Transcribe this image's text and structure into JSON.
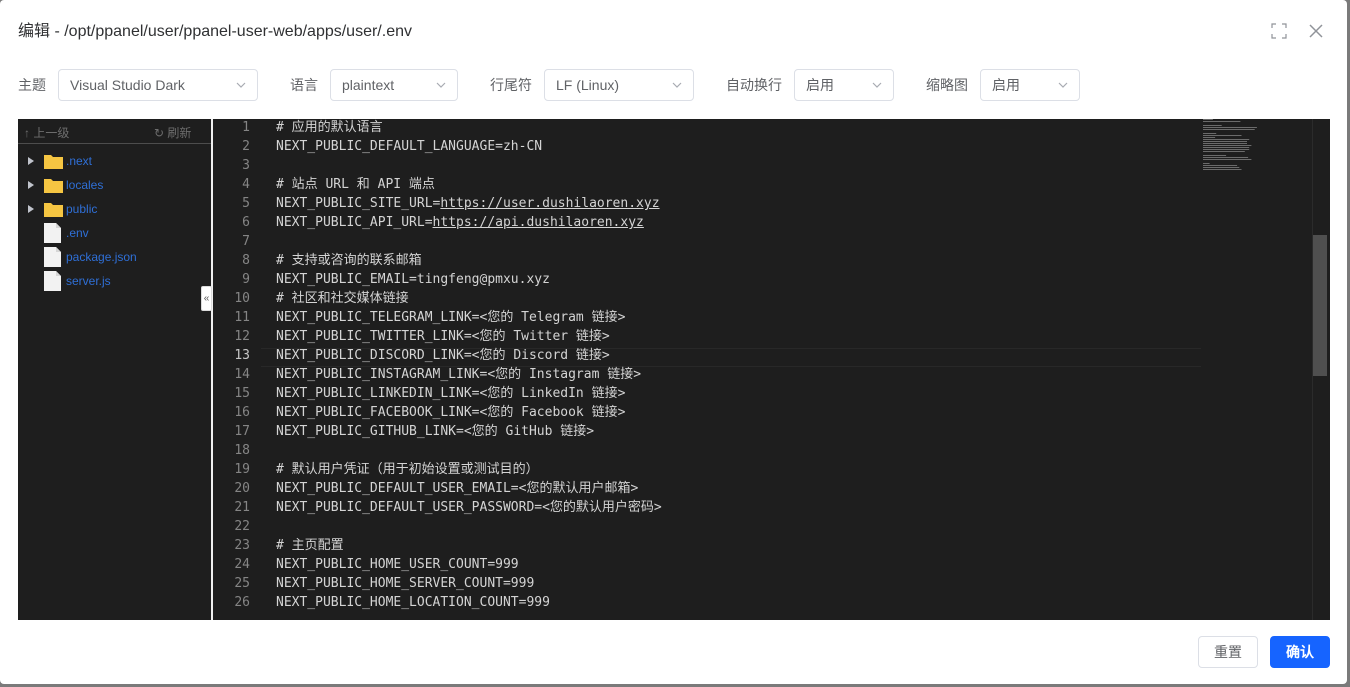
{
  "dialog": {
    "title": "编辑 - /opt/ppanel/user/ppanel-user-web/apps/user/.env",
    "fullscreen_icon": "fullscreen-icon",
    "close_icon": "close-icon"
  },
  "toolbar": {
    "theme_label": "主题",
    "theme_value": "Visual Studio Dark",
    "language_label": "语言",
    "language_value": "plaintext",
    "eol_label": "行尾符",
    "eol_value": "LF (Linux)",
    "wrap_label": "自动换行",
    "wrap_value": "启用",
    "minimap_label": "缩略图",
    "minimap_value": "启用"
  },
  "tree": {
    "up_label": "上一级",
    "refresh_label": "刷新",
    "items": [
      {
        "name": ".next",
        "type": "folder"
      },
      {
        "name": "locales",
        "type": "folder"
      },
      {
        "name": "public",
        "type": "folder"
      },
      {
        "name": ".env",
        "type": "file"
      },
      {
        "name": "package.json",
        "type": "file"
      },
      {
        "name": "server.js",
        "type": "file"
      }
    ]
  },
  "editor": {
    "active_line": 13,
    "lines": [
      "# 应用的默认语言",
      "NEXT_PUBLIC_DEFAULT_LANGUAGE=zh-CN",
      "",
      "# 站点 URL 和 API 端点",
      "NEXT_PUBLIC_SITE_URL=https://user.dushilaoren.xyz",
      "NEXT_PUBLIC_API_URL=https://api.dushilaoren.xyz",
      "",
      "# 支持或咨询的联系邮箱",
      "NEXT_PUBLIC_EMAIL=tingfeng@pmxu.xyz",
      "# 社区和社交媒体链接",
      "NEXT_PUBLIC_TELEGRAM_LINK=<您的 Telegram 链接>",
      "NEXT_PUBLIC_TWITTER_LINK=<您的 Twitter 链接>",
      "NEXT_PUBLIC_DISCORD_LINK=<您的 Discord 链接>",
      "NEXT_PUBLIC_INSTAGRAM_LINK=<您的 Instagram 链接>",
      "NEXT_PUBLIC_LINKEDIN_LINK=<您的 LinkedIn 链接>",
      "NEXT_PUBLIC_FACEBOOK_LINK=<您的 Facebook 链接>",
      "NEXT_PUBLIC_GITHUB_LINK=<您的 GitHub 链接>",
      "",
      "# 默认用户凭证（用于初始设置或测试目的）",
      "NEXT_PUBLIC_DEFAULT_USER_EMAIL=<您的默认用户邮箱>",
      "NEXT_PUBLIC_DEFAULT_USER_PASSWORD=<您的默认用户密码>",
      "",
      "# 主页配置",
      "NEXT_PUBLIC_HOME_USER_COUNT=999",
      "NEXT_PUBLIC_HOME_SERVER_COUNT=999",
      "NEXT_PUBLIC_HOME_LOCATION_COUNT=999"
    ],
    "link_prefixes": {
      "NEXT_PUBLIC_SITE_URL=": "https://user.dushilaoren.xyz",
      "NEXT_PUBLIC_API_URL=": "https://api.dushilaoren.xyz"
    }
  },
  "footer": {
    "reset_label": "重置",
    "confirm_label": "确认"
  },
  "colors": {
    "accent": "#1664ff",
    "editor_bg": "#1e1e1e",
    "folder": "#f5c542"
  }
}
